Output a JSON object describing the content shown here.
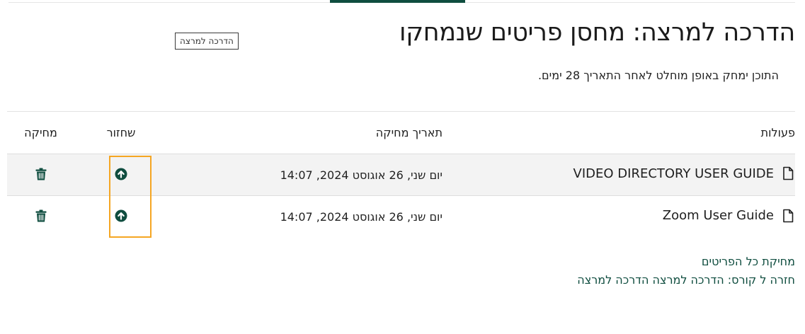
{
  "page": {
    "title": "הדרכה למרצה: מחסן פריטים שנמחקו",
    "course_badge": "הדרכה למרצה",
    "notice": "התוכן ימחק באופן מוחלט לאחר התאריך 28 ימים."
  },
  "table": {
    "headers": {
      "actions": "פעולות",
      "deleted_date": "תאריך מחיקה",
      "restore": "שחזור",
      "delete": "מחיקה"
    },
    "rows": [
      {
        "name": "VIDEO DIRECTORY USER GUIDE",
        "date": "יום שני, 26 אוגוסט 2024, 14:07"
      },
      {
        "name": "Zoom User Guide",
        "date": "יום שני, 26 אוגוסט 2024, 14:07"
      }
    ]
  },
  "footer": {
    "delete_all": "מחיקת כל הפריטים",
    "back_to_course": "חזרה ל קורס: הדרכה למרצה הדרכה למרצה"
  },
  "icons": {
    "file": "file-icon",
    "restore": "arrow-up-circle-icon",
    "delete": "trash-icon"
  },
  "colors": {
    "brand": "#0f4d3f",
    "highlight": "#f5a623",
    "row_stripe": "#f3f3f3"
  }
}
